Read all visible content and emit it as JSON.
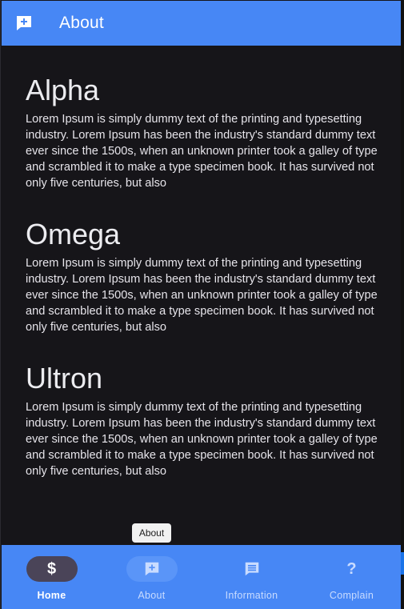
{
  "appbar": {
    "icon": "add-comment-icon",
    "title": "About"
  },
  "sections": [
    {
      "heading": "Alpha",
      "body": "Lorem Ipsum is simply dummy text of the printing and typesetting industry. Lorem Ipsum has been the industry's standard dummy text ever since the 1500s, when an unknown printer took a galley of type and scrambled it to make a type specimen book. It has survived not only five centuries, but also"
    },
    {
      "heading": "Omega",
      "body": "Lorem Ipsum is simply dummy text of the printing and typesetting industry. Lorem Ipsum has been the industry's standard dummy text ever since the 1500s, when an unknown printer took a galley of type and scrambled it to make a type specimen book. It has survived not only five centuries, but also"
    },
    {
      "heading": "Ultron",
      "body": "Lorem Ipsum is simply dummy text of the printing and typesetting industry. Lorem Ipsum has been the industry's standard dummy text ever since the 1500s, when an unknown printer took a galley of type and scrambled it to make a type specimen book. It has survived not only five centuries, but also"
    }
  ],
  "tooltip": {
    "text": "About"
  },
  "bottom_nav": {
    "items": [
      {
        "label": "Home",
        "icon": "dollar-icon",
        "glyph": "$",
        "active": true
      },
      {
        "label": "About",
        "icon": "add-comment-icon",
        "active": false
      },
      {
        "label": "Information",
        "icon": "comment-icon",
        "active": false
      },
      {
        "label": "Complain",
        "icon": "question-icon",
        "glyph": "?",
        "active": false
      }
    ]
  },
  "colors": {
    "primary": "#4787f5",
    "background": "#161519",
    "active_indicator": "#4a4458",
    "on_primary": "#ffffff"
  }
}
